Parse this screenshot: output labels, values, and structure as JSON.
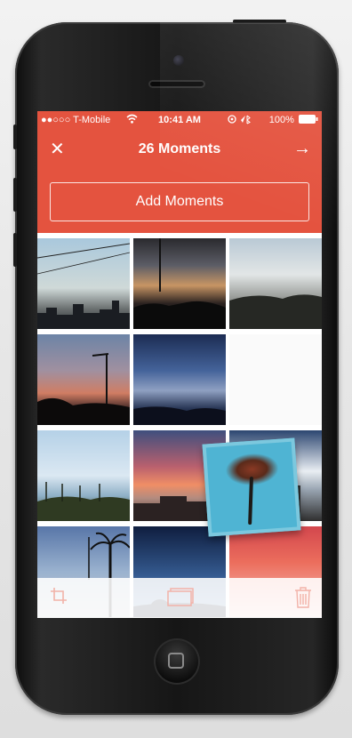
{
  "status_bar": {
    "carrier": "●●○○○ T-Mobile",
    "wifi_icon": "wifi-icon",
    "time": "10:41 AM",
    "battery": "100%"
  },
  "nav": {
    "close_label": "✕",
    "title": "26 Moments",
    "next_label": "→"
  },
  "add_moments": {
    "label": "Add Moments"
  },
  "toolbar": {
    "crop_icon": "crop-icon",
    "album_icon": "album-icon",
    "trash_icon": "trash-icon"
  },
  "colors": {
    "accent": "#e4533f",
    "toolbar_icon": "#f2b2a8"
  },
  "grid": {
    "photo_count_visible": 12,
    "floating_photo": "palm-tree-photo"
  }
}
